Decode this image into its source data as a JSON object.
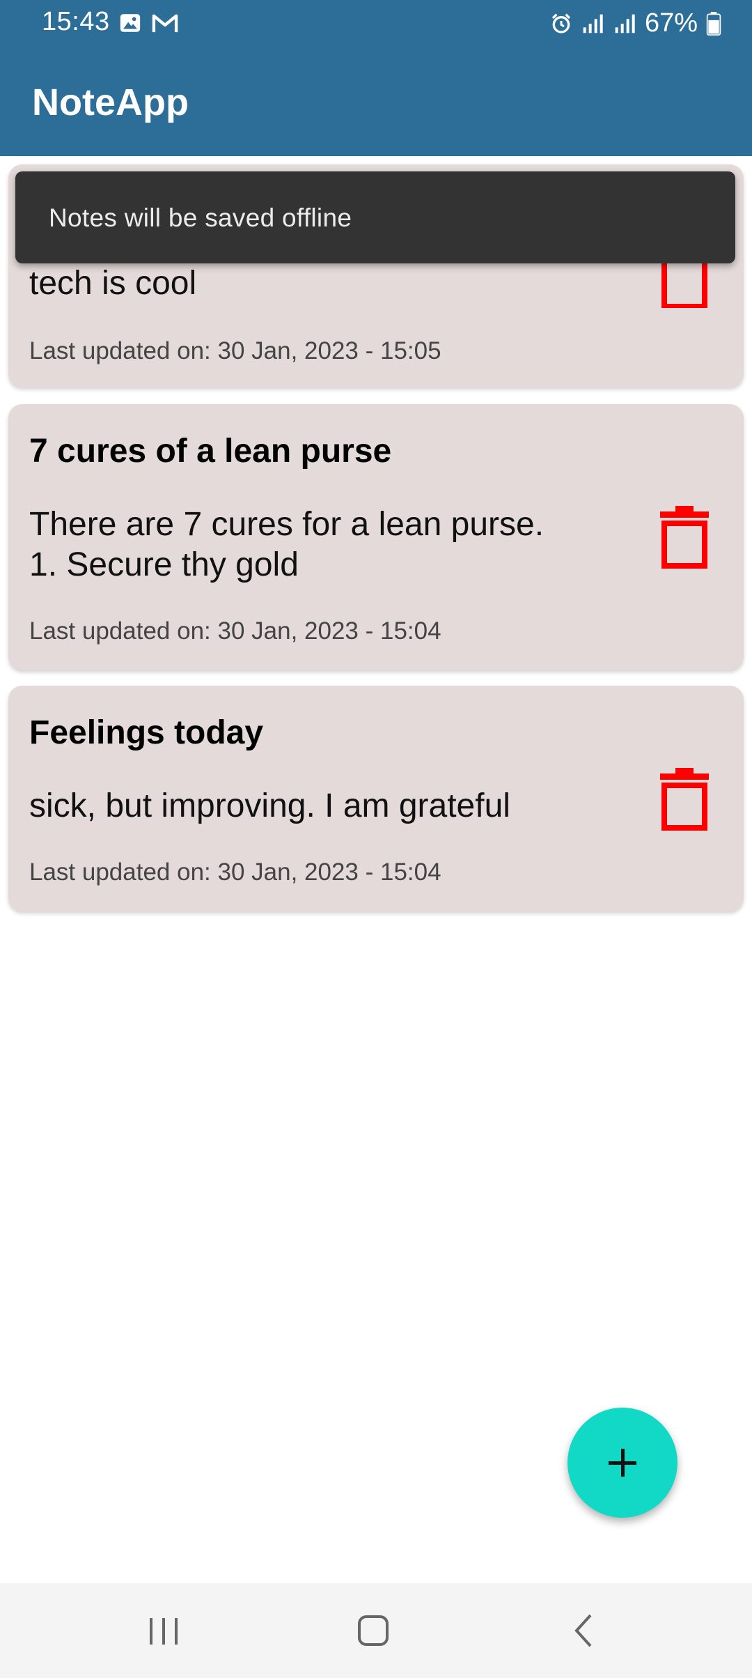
{
  "status_bar": {
    "time": "15:43",
    "battery": "67%",
    "icons": [
      "gallery-icon",
      "gmail-icon",
      "alarm-icon",
      "signal-icon",
      "signal-icon",
      "battery-icon"
    ]
  },
  "app_bar": {
    "title": "NoteApp",
    "color": "#2d6e99"
  },
  "snackbar": {
    "message": "Notes will be saved offline"
  },
  "notes": [
    {
      "title": "",
      "body": "tech is cool",
      "updated": "Last updated on: 30 Jan, 2023 - 15:05"
    },
    {
      "title": "7 cures of a lean purse",
      "body_line1": "There are 7 cures for a lean purse.",
      "body_line2": "1. Secure thy gold",
      "updated": "Last updated on: 30 Jan, 2023 - 15:04"
    },
    {
      "title": "Feelings today",
      "body": "sick, but improving. I am grateful",
      "updated": "Last updated on: 30 Jan, 2023 - 15:04"
    }
  ],
  "colors": {
    "card_bg": "#e4dada",
    "delete_icon": "#ff0000",
    "fab": "#12d9c5"
  },
  "fab": {
    "icon": "plus-icon"
  },
  "nav_bar": {
    "icons": [
      "recent-apps-icon",
      "home-icon",
      "back-icon"
    ]
  }
}
